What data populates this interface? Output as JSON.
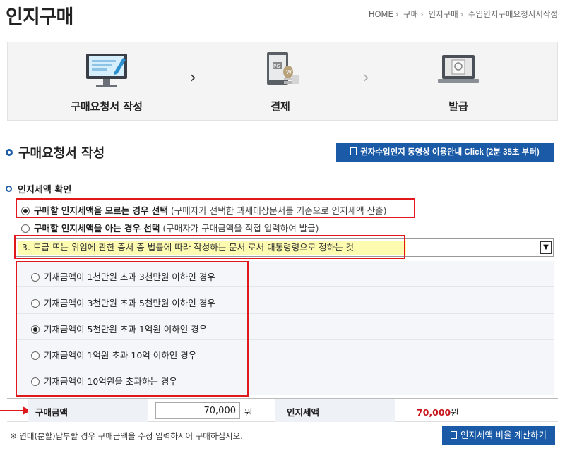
{
  "page": {
    "title": "인지구매",
    "breadcrumb": [
      "HOME",
      "구매",
      "인지구매",
      "수입인지구매요청서서작성"
    ]
  },
  "steps": [
    {
      "label": "구매요청서 작성",
      "icon": "monitor-pen-icon"
    },
    {
      "label": "결제",
      "icon": "payment-pg-icon"
    },
    {
      "label": "발급",
      "icon": "laptop-stamp-icon"
    }
  ],
  "section": {
    "title": "구매요청서 작성",
    "video_button": "권자수입인지 동영상 이용안내 Click (2분 35초 부터)"
  },
  "tax_check": {
    "title": "인지세액 확인",
    "options": [
      {
        "bold": "구매할 인지세액을 모르는 경우 선택",
        "note": "(구매자가 선택한 과세대상문서를 기준으로 인지세액 산출)",
        "checked": true
      },
      {
        "bold": "구매할 인지세액을 아는 경우 선택",
        "note": "(구매자가 구매금액을 직접 입력하여 발급)",
        "checked": false
      }
    ],
    "document_select": "3. 도급 또는 위임에 관한 증서 중 법률에 따라 작성하는 문서 로서 대통령령으로 정하는 것"
  },
  "amount_options": [
    {
      "label": "기재금액이 1천만원 초과 3천만원 이하인 경우",
      "checked": false
    },
    {
      "label": "기재금액이 3천만원 초과 5천만원 이하인 경우",
      "checked": false
    },
    {
      "label": "기재금액이 5천만원 초과 1억원 이하인 경우",
      "checked": true
    },
    {
      "label": "기재금액이 1억원 초과 10억 이하인 경우",
      "checked": false
    },
    {
      "label": "기재금액이 10억원을 초과하는 경우",
      "checked": false
    }
  ],
  "totals": {
    "purchase_label": "구매금액",
    "purchase_value": "70,000",
    "unit": "원",
    "tax_label": "인지세액",
    "tax_value": "70,000",
    "tax_unit": "원"
  },
  "footer": {
    "note": "※ 연대(분할)납부할 경우 구매금액을 수정 입력하시어 구매하십시오.",
    "calc_button": "인지세액 비율 계산하기"
  },
  "colors": {
    "accent": "#1a5aa6",
    "highlight_box": "#e0171b",
    "select_highlight": "#fdfbb0"
  }
}
